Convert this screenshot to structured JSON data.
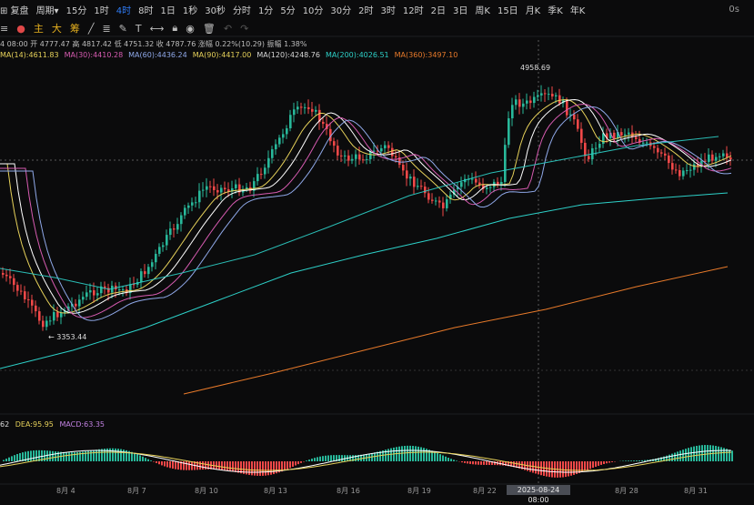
{
  "toolbar": {
    "items": [
      "⊞ 复盘",
      "周期▾",
      "15分",
      "1时",
      "4时",
      "8时",
      "1日",
      "1秒",
      "30秒",
      "分时",
      "1分",
      "5分",
      "10分",
      "30分",
      "2时",
      "3时",
      "12时",
      "2日",
      "3日",
      "周K",
      "15日",
      "月K",
      "季K",
      "年K"
    ],
    "active": "4时",
    "right": "0s"
  },
  "tools": {
    "zhu": "主",
    "da": "大",
    "chou": "筹"
  },
  "info": "4 08:00 开 4777.47  高 4817.42  低 4751.32  收 4787.76  涨幅 0.22%(10.29)  振幅 1.38%",
  "ma": [
    {
      "label": "MA(14):4611.83",
      "color": "#e6d15a"
    },
    {
      "label": "MA(30):4410.28",
      "color": "#d65bb0"
    },
    {
      "label": "MA(60):4436.24",
      "color": "#8fa8e8"
    },
    {
      "label": "MA(90):4417.00",
      "color": "#e6d15a"
    },
    {
      "label": "MA(120):4248.76",
      "color": "#d8d8d8"
    },
    {
      "label": "MA(200):4026.51",
      "color": "#2dd0c8"
    },
    {
      "label": "MA(360):3497.10",
      "color": "#e87a2a"
    }
  ],
  "macd": {
    "dif": "62",
    "dea": "DEA:95.95",
    "macd": "MACD:63.35"
  },
  "price_labels": {
    "high": "4958.69",
    "low": "← 3353.44"
  },
  "x_labels": [
    "8月 4",
    "8月 7",
    "8月 10",
    "8月 13",
    "8月 16",
    "8月 19",
    "8月 22",
    "8月 28",
    "8月 31"
  ],
  "x_selected": "2025-08-24 08:00",
  "chart_data": {
    "type": "candlestick",
    "x": [
      "8月 4",
      "8月 7",
      "8月 10",
      "8月 13",
      "8月 16",
      "8月 19",
      "8月 22",
      "2025-08-24 08:00",
      "8月 28",
      "8月 31"
    ],
    "high": 4958.69,
    "low": 3353.44,
    "close_last": 4787.76
  },
  "colors": {
    "up": "#28b89a",
    "down": "#f04848",
    "accent": "#2f7cf6"
  }
}
